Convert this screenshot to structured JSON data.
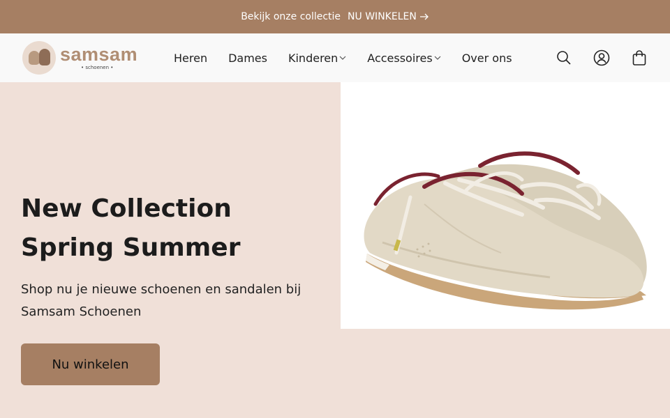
{
  "announcement": {
    "text": "Bekijk onze collectie",
    "link_label": "NU WINKELEN"
  },
  "logo": {
    "name": "samsam",
    "subtitle": "• schoenen •"
  },
  "nav": {
    "items": [
      {
        "label": "Heren",
        "has_dropdown": false
      },
      {
        "label": "Dames",
        "has_dropdown": false
      },
      {
        "label": "Kinderen",
        "has_dropdown": true
      },
      {
        "label": "Accessoires",
        "has_dropdown": true
      },
      {
        "label": "Over ons",
        "has_dropdown": false
      }
    ]
  },
  "header_icons": [
    "search-icon",
    "account-icon",
    "shopping-bag-icon"
  ],
  "hero": {
    "title_line1": "New Collection",
    "title_line2": "Spring Summer",
    "subtitle": "Shop nu je nieuwe schoenen en sandalen bij Samsam Schoenen",
    "button_label": "Nu winkelen"
  },
  "colors": {
    "brand": "#a67f63",
    "hero_bg": "#f0e0d8",
    "header_bg": "#f9f9f9"
  }
}
